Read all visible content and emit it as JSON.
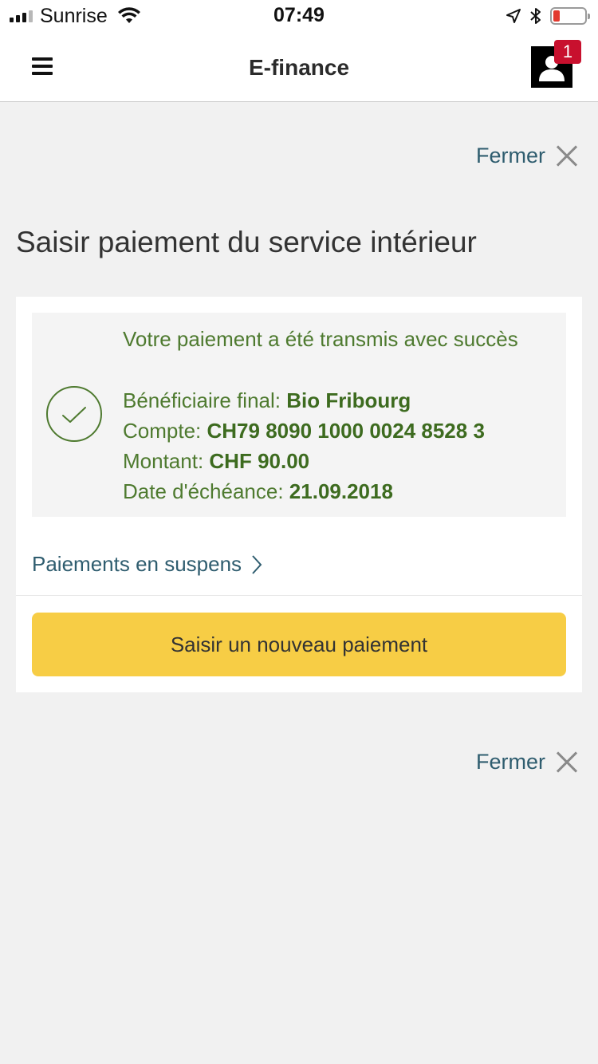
{
  "status_bar": {
    "carrier": "Sunrise",
    "time": "07:49",
    "battery_level": 0.2,
    "battery_color": "#e23a2f",
    "icons": [
      "signal-icon",
      "wifi-icon",
      "location-arrow-icon",
      "bluetooth-icon",
      "battery-icon"
    ]
  },
  "header": {
    "title": "E-finance",
    "notification_count": "1",
    "badge_color": "#c8102e"
  },
  "close_top": {
    "label": "Fermer"
  },
  "page_title": "Saisir paiement du service intérieur",
  "confirmation": {
    "message": "Votre paiement a été transmis avec succès",
    "beneficiary_label": "Bénéficiaire final:",
    "beneficiary_value": "Bio Fribourg",
    "account_label": "Compte:",
    "account_value": "CH79 8090 1000 0024 8528 3",
    "amount_label": "Montant:",
    "amount_value": "CHF 90.00",
    "due_date_label": "Date d'échéance:",
    "due_date_value": "21.09.2018",
    "accent_color": "#4e7a2f"
  },
  "pending_link": {
    "label": "Paiements en suspens"
  },
  "new_payment_button": {
    "label": "Saisir un nouveau paiement",
    "color": "#f7cd45"
  },
  "close_bottom": {
    "label": "Fermer"
  }
}
